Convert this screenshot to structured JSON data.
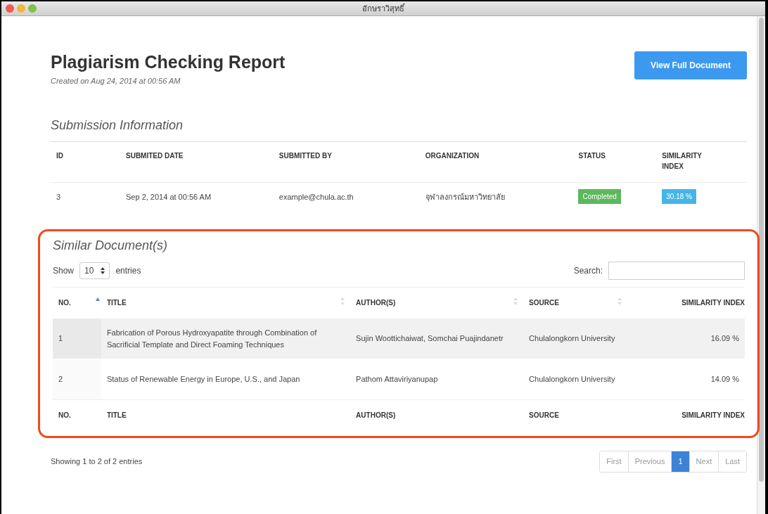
{
  "window": {
    "title": "อักษราวิสุทธิ์"
  },
  "header": {
    "title": "Plagiarism Checking Report",
    "created": "Created on Aug 24, 2014 at 00:56 AM",
    "button": "View Full Document"
  },
  "submission": {
    "heading": "Submission Information",
    "columns": [
      "ID",
      "SUBMITED DATE",
      "SUBMITTED BY",
      "ORGANIZATION",
      "STATUS",
      "SIMILARITY INDEX"
    ],
    "row": [
      {
        "kind": "text",
        "text": "3"
      },
      {
        "kind": "text",
        "text": "Sep 2, 2014 at 00:56 AM"
      },
      {
        "kind": "text",
        "text": "example@chula.ac.th"
      },
      {
        "kind": "text",
        "text": "จุฬาลงกรณ์มหาวิทยาลัย"
      },
      {
        "kind": "success",
        "text": "Completed"
      },
      {
        "kind": "info",
        "text": "30.18 %"
      }
    ]
  },
  "similar": {
    "heading": "Similar Document(s)",
    "highlighted": true,
    "length": {
      "show": "Show",
      "value": "10",
      "entries": "entries"
    },
    "search": {
      "label": "Search:"
    },
    "columns": [
      {
        "label": "NO.",
        "sortable": true,
        "sorted": true
      },
      {
        "label": "TITLE",
        "sortable": true,
        "sorted": false
      },
      {
        "label": "AUTHOR(S)",
        "sortable": true,
        "sorted": false
      },
      {
        "label": "SOURCE",
        "sortable": true,
        "sorted": false
      },
      {
        "label": "SIMILARITY INDEX",
        "sortable": false,
        "sorted": false
      }
    ],
    "rows": [
      {
        "no": "1",
        "title": "Fabrication of Porous Hydroxyapatite through Combination of Sacrificial Template and Direct Foaming Techniques",
        "authors": "Sujin Woottichaiwat, Somchai Puajindanetr",
        "source": "Chulalongkorn University",
        "similarity": "16.09 %"
      },
      {
        "no": "2",
        "title": "Status of Renewable Energy in Europe, U.S., and Japan",
        "authors": "Pathom Attaviriyanupap",
        "source": "Chulalongkorn University",
        "similarity": "14.09 %"
      }
    ],
    "footer": [
      "NO.",
      "TITLE",
      "AUTHOR(S)",
      "SOURCE",
      "SIMILARITY INDEX"
    ]
  },
  "info": "Showing 1 to 2 of 2 entries",
  "pagination": [
    {
      "label": "First",
      "selected": false
    },
    {
      "label": "Previous",
      "selected": false
    },
    {
      "label": "1",
      "selected": true
    },
    {
      "label": "Next",
      "selected": false
    },
    {
      "label": "Last",
      "selected": false
    }
  ]
}
